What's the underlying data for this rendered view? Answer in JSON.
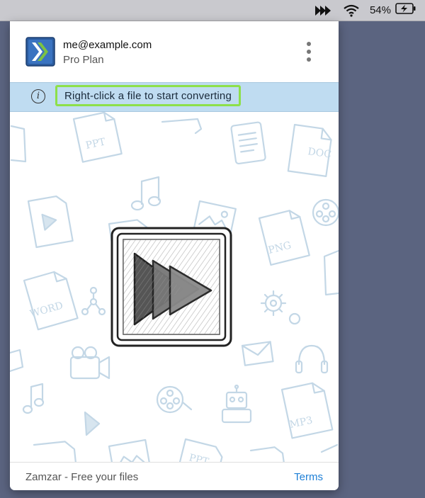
{
  "menubar": {
    "app_icon": "fast-forward-icon",
    "wifi_icon": "wifi-icon",
    "battery_percent": "54%",
    "battery_icon": "battery-charging-icon"
  },
  "header": {
    "email": "me@example.com",
    "plan": "Pro Plan",
    "logo_icon": "zamzar-logo",
    "menu_icon": "more-vertical-icon"
  },
  "banner": {
    "icon": "info-icon",
    "info_glyph": "i",
    "message": "Right-click a file to start converting",
    "highlight_color": "#8de04a",
    "background_color": "#bfdcf1"
  },
  "content": {
    "center_icon": "fast-forward-sketch-icon",
    "background_labels": [
      "PPT",
      "DOC",
      "PNG",
      "WORD",
      "MP3",
      "PPT"
    ]
  },
  "footer": {
    "tagline": "Zamzar - Free your files",
    "terms_label": "Terms",
    "link_color": "#1e7fd6"
  }
}
